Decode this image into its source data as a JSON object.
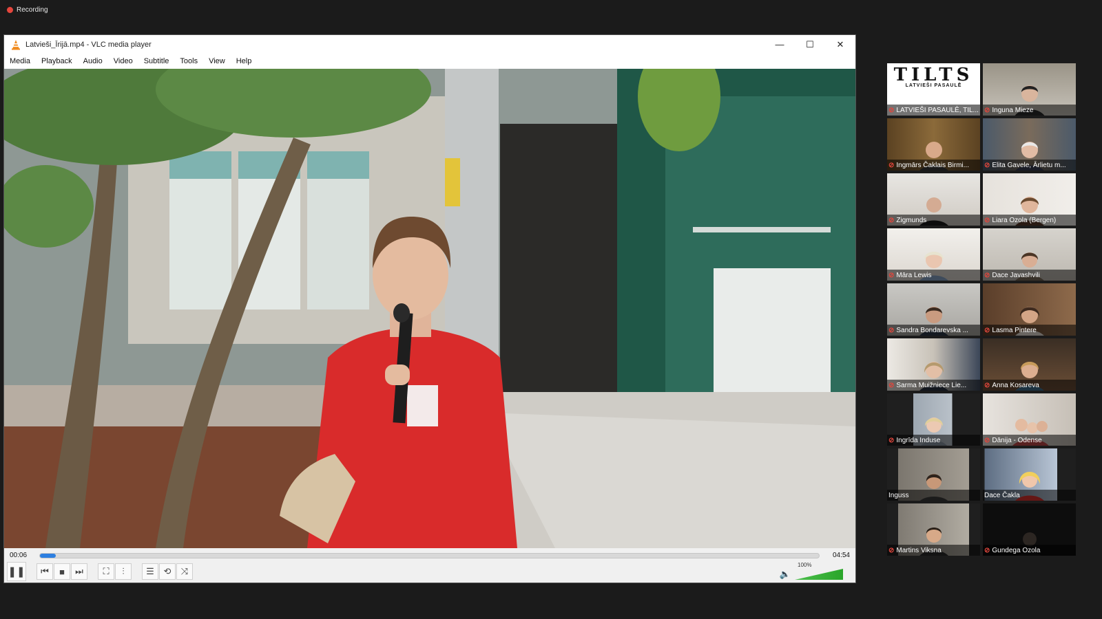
{
  "recording": {
    "label": "Recording"
  },
  "window": {
    "title": "Latvieši_Īrijā.mp4 - VLC media player",
    "controls": {
      "minimize": "—",
      "maximize": "☐",
      "close": "✕"
    }
  },
  "menu": {
    "items": [
      "Media",
      "Playback",
      "Audio",
      "Video",
      "Subtitle",
      "Tools",
      "View",
      "Help"
    ]
  },
  "player": {
    "current_time": "00:06",
    "total_time": "04:54",
    "progress": 0.02,
    "volume_label": "100%",
    "icons": {
      "pause": "❚❚",
      "prev": "⏮",
      "stop": "■",
      "next": "⏭",
      "fullscreen": "⛶",
      "extended": "⫶",
      "playlist": "☰",
      "loop": "⟲",
      "shuffle": "⤨",
      "volume": "🔈"
    }
  },
  "participants": [
    {
      "name": "LATVIEŠI PASAULĒ, TIL..."
    },
    {
      "name": "Inguna Mieze"
    },
    {
      "name": "Ingmārs Čaklais Birmi..."
    },
    {
      "name": "Elita Gavele, Ārlietu m..."
    },
    {
      "name": "Zigmunds"
    },
    {
      "name": "Liara Ozola (Bergen)"
    },
    {
      "name": "Māra Lewis"
    },
    {
      "name": "Dace Javashvili"
    },
    {
      "name": "Sandra Bondarevska ..."
    },
    {
      "name": "Lasma Pintere"
    },
    {
      "name": "Sarma Muižniece Lie..."
    },
    {
      "name": "Anna Kosareva"
    },
    {
      "name": "Ingrīda Induse"
    },
    {
      "name": "Dānija - Odense"
    },
    {
      "name": "Inguss"
    },
    {
      "name": "Dace Čakla"
    },
    {
      "name": "Martins Viksna"
    },
    {
      "name": "Gundega Ozola"
    }
  ],
  "tilts_logo": {
    "title": "TILTS",
    "subtitle": "LATVIEŠI PASAULĒ"
  },
  "colors": {
    "accent": "#2d7fe0",
    "mic_muted": "#e0463c",
    "active_speaker": "#e6d15a"
  }
}
